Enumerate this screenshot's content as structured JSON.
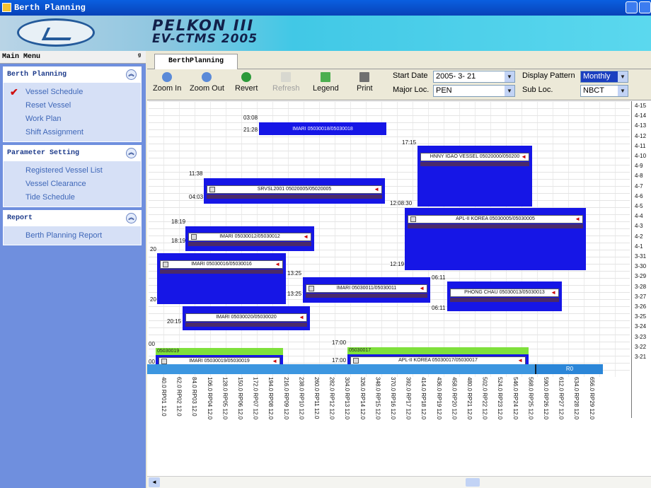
{
  "window": {
    "title": "Berth Planning"
  },
  "banner": {
    "line1": "PELKON III",
    "line2": "EV-CTMS 2005"
  },
  "sidebar": {
    "header": "Main Menu",
    "pin": "ᵍ",
    "groups": [
      {
        "title": "Berth Planning",
        "items": [
          "Vessel Schedule",
          "Reset Vessel",
          "Work Plan",
          "Shift Assignment"
        ]
      },
      {
        "title": "Parameter Setting",
        "items": [
          "Registered Vessel List",
          "Vessel Clearance",
          "Tide Schedule"
        ]
      },
      {
        "title": "Report",
        "items": [
          "Berth Planning Report"
        ]
      }
    ]
  },
  "tabs": {
    "active": "BerthPlanning"
  },
  "toolbar": {
    "zoom_in": "Zoom In",
    "zoom_out": "Zoom Out",
    "revert": "Revert",
    "refresh": "Refresh",
    "legend": "Legend",
    "print": "Print",
    "start_date_label": "Start Date",
    "start_date": "2005- 3- 21",
    "major_loc_label": "Major Loc.",
    "major_loc": "PEN",
    "display_pattern_label": "Display Pattern",
    "display_pattern": "Monthly",
    "sub_loc_label": "Sub Loc.",
    "sub_loc": "NBCT"
  },
  "date_ticks": [
    "4-15",
    "4-14",
    "4-13",
    "4-12",
    "4-11",
    "4-10",
    "4-9",
    "4-8",
    "4-7",
    "4-6",
    "4-5",
    "4-4",
    "4-3",
    "4-2",
    "4-1",
    "3-31",
    "3-30",
    "3-29",
    "3-28",
    "3-27",
    "3-26",
    "3-25",
    "3-24",
    "3-23",
    "3-22",
    "3-21"
  ],
  "vessels": [
    {
      "label": "IMARI 05030018/05030018",
      "times": [
        "03:08",
        "21:28"
      ]
    },
    {
      "label": "HNNY IGAO VESSEL 05020000/050200",
      "times": [
        "17:15"
      ]
    },
    {
      "label": "SRVSL2001 05020005/05020005",
      "times": [
        "11:38",
        "04:03"
      ]
    },
    {
      "label": "APL-II KOREA 05030005/05030005",
      "times": [
        "12:08:30",
        "12:19"
      ]
    },
    {
      "label": "IMARI 05030012/05030012",
      "times": [
        "18:19",
        "18:19"
      ]
    },
    {
      "label": "IMARI 05030016/05030016",
      "times": [
        "20",
        "20"
      ]
    },
    {
      "label": "IMARI 05030011/05030011",
      "times": [
        "13:25",
        "13:25"
      ]
    },
    {
      "label": "PHONG CHAU 05030013/05030013",
      "times": [
        "06:11",
        "06:11"
      ]
    },
    {
      "label": "IMARI 05030020/05030020",
      "times": [
        "20:15"
      ]
    },
    {
      "label": "IMARI 05030019/05030019",
      "header": "05030019",
      "times": [
        "00",
        "00"
      ]
    },
    {
      "label": "APL-II KOREA 05030017/05030017",
      "header": "05030017",
      "times": [
        "17:00",
        "17:00"
      ]
    }
  ],
  "berth_end_label": "R0",
  "rp_labels": [
    "40.0 RP01 12.0",
    "62.0 RP02 12.0",
    "84.0 RP03 12.0",
    "106.0 RP04 12.0",
    "128.0 RP05 12.0",
    "150.0 RP06 12.0",
    "172.0 RP07 12.0",
    "194.0 RP08 12.0",
    "216.0 RP09 12.0",
    "238.0 RP10 12.0",
    "260.0 RP11 12.0",
    "282.0 RP12 12.0",
    "304.0 RP13 12.0",
    "326.0 RP14 12.0",
    "348.0 RP15 12.0",
    "370.0 RP16 12.0",
    "392.0 RP17 12.0",
    "414.0 RP18 12.0",
    "436.0 RP19 12.0",
    "458.0 RP20 12.0",
    "480.0 RP21 12.0",
    "502.0 RP22 12.0",
    "524.0 RP23 12.0",
    "546.0 RP24 12.0",
    "568.0 RP25 12.0",
    "590.0 RP26 12.0",
    "612.0 RP27 12.0",
    "634.0 RP28 12.0",
    "656.0 RP29 12.0"
  ]
}
